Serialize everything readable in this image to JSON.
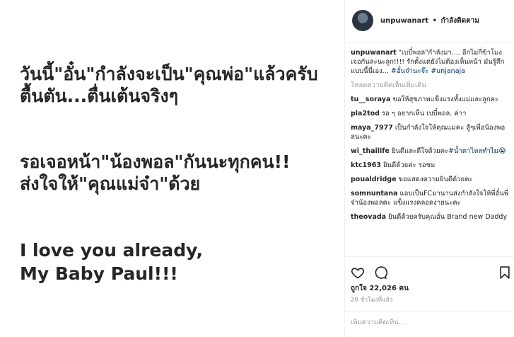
{
  "image": {
    "lines_th_1": "วันนี้\"อั๋น\"กำลังจะเป็น\"คุณพ่อ\"แล้วครับ\nตื้นตัน...ตื่นเต้นจริงๆ",
    "lines_th_2": "รอเจอหน้า\"น้องพอล\"กันนะทุกคน!!\nส่งใจให้\"คุณแม่จ๋า\"ด้วย",
    "lines_en": "I love you already,\nMy Baby Paul!!!"
  },
  "header": {
    "username": "unpuwanart",
    "separator": "•",
    "following_label": "กำลังติดตาม"
  },
  "caption": {
    "username": "unpuwanart",
    "text": "\"เบบี๋พอล\"กำลังมา.... อีกไม่กี่ข้าโมงเจอกันละนะลูก!!!! รักตั้งแต่ยังไม่ต้องเห็นหน้า มันรู้สึกแบบนี้นี่เอง...",
    "hashtags": "#อั๋นจ๋านะจ๊ะ #unjanaja"
  },
  "load_more_label": "โหลดความคิดเห็นเพิ่มเติม",
  "comments": [
    {
      "username": "tu__soraya",
      "text": "ขอให้สุขภาพแข็งแรงทั้งแม่และลูกคะ",
      "tag": ""
    },
    {
      "username": "pla2tod",
      "text": "รอ ๆ อยากเห็น เบบี๋พอล. ค่าา",
      "tag": ""
    },
    {
      "username": "maya_7977",
      "text": "เป็นกำลังใจให้คุณแม่คะ สู้ๆเพื่อน้องพอลนะคะ",
      "tag": ""
    },
    {
      "username": "wi_thailife",
      "text": "ยินดีและดีใจด้วยคะ",
      "tag": "#น้ำตาไหลทำไม😭"
    },
    {
      "username": "ktc1963",
      "text": "ยินดีด้วยค่ะ รอชม",
      "tag": ""
    },
    {
      "username": "poualdridge",
      "text": "ขอแสดงความยินดีด้วยคะ",
      "tag": ""
    },
    {
      "username": "somnuntana",
      "text": "แอบเป็นFCมานานส่งกำลังใจให้พี่อั๋นพี่จ๋าน้องพอลคะ แข็งแรงคลอดง่ายนะคะ",
      "tag": ""
    },
    {
      "username": "theovada",
      "text": "ยินดีด้วยครับคุณอั๋น Brand new Daddy",
      "tag": ""
    }
  ],
  "icons": {
    "like": "heart-icon",
    "comment": "comment-icon",
    "save": "bookmark-icon"
  },
  "likes_label": "ถูกใจ 22,026 คน",
  "time_label": "20 ชั่วโมงที่แล้ว",
  "add_comment_placeholder": "เพิ่มความคิดเห็น...",
  "colors": {
    "link": "#003569",
    "muted": "#999999",
    "border": "#efefef"
  }
}
